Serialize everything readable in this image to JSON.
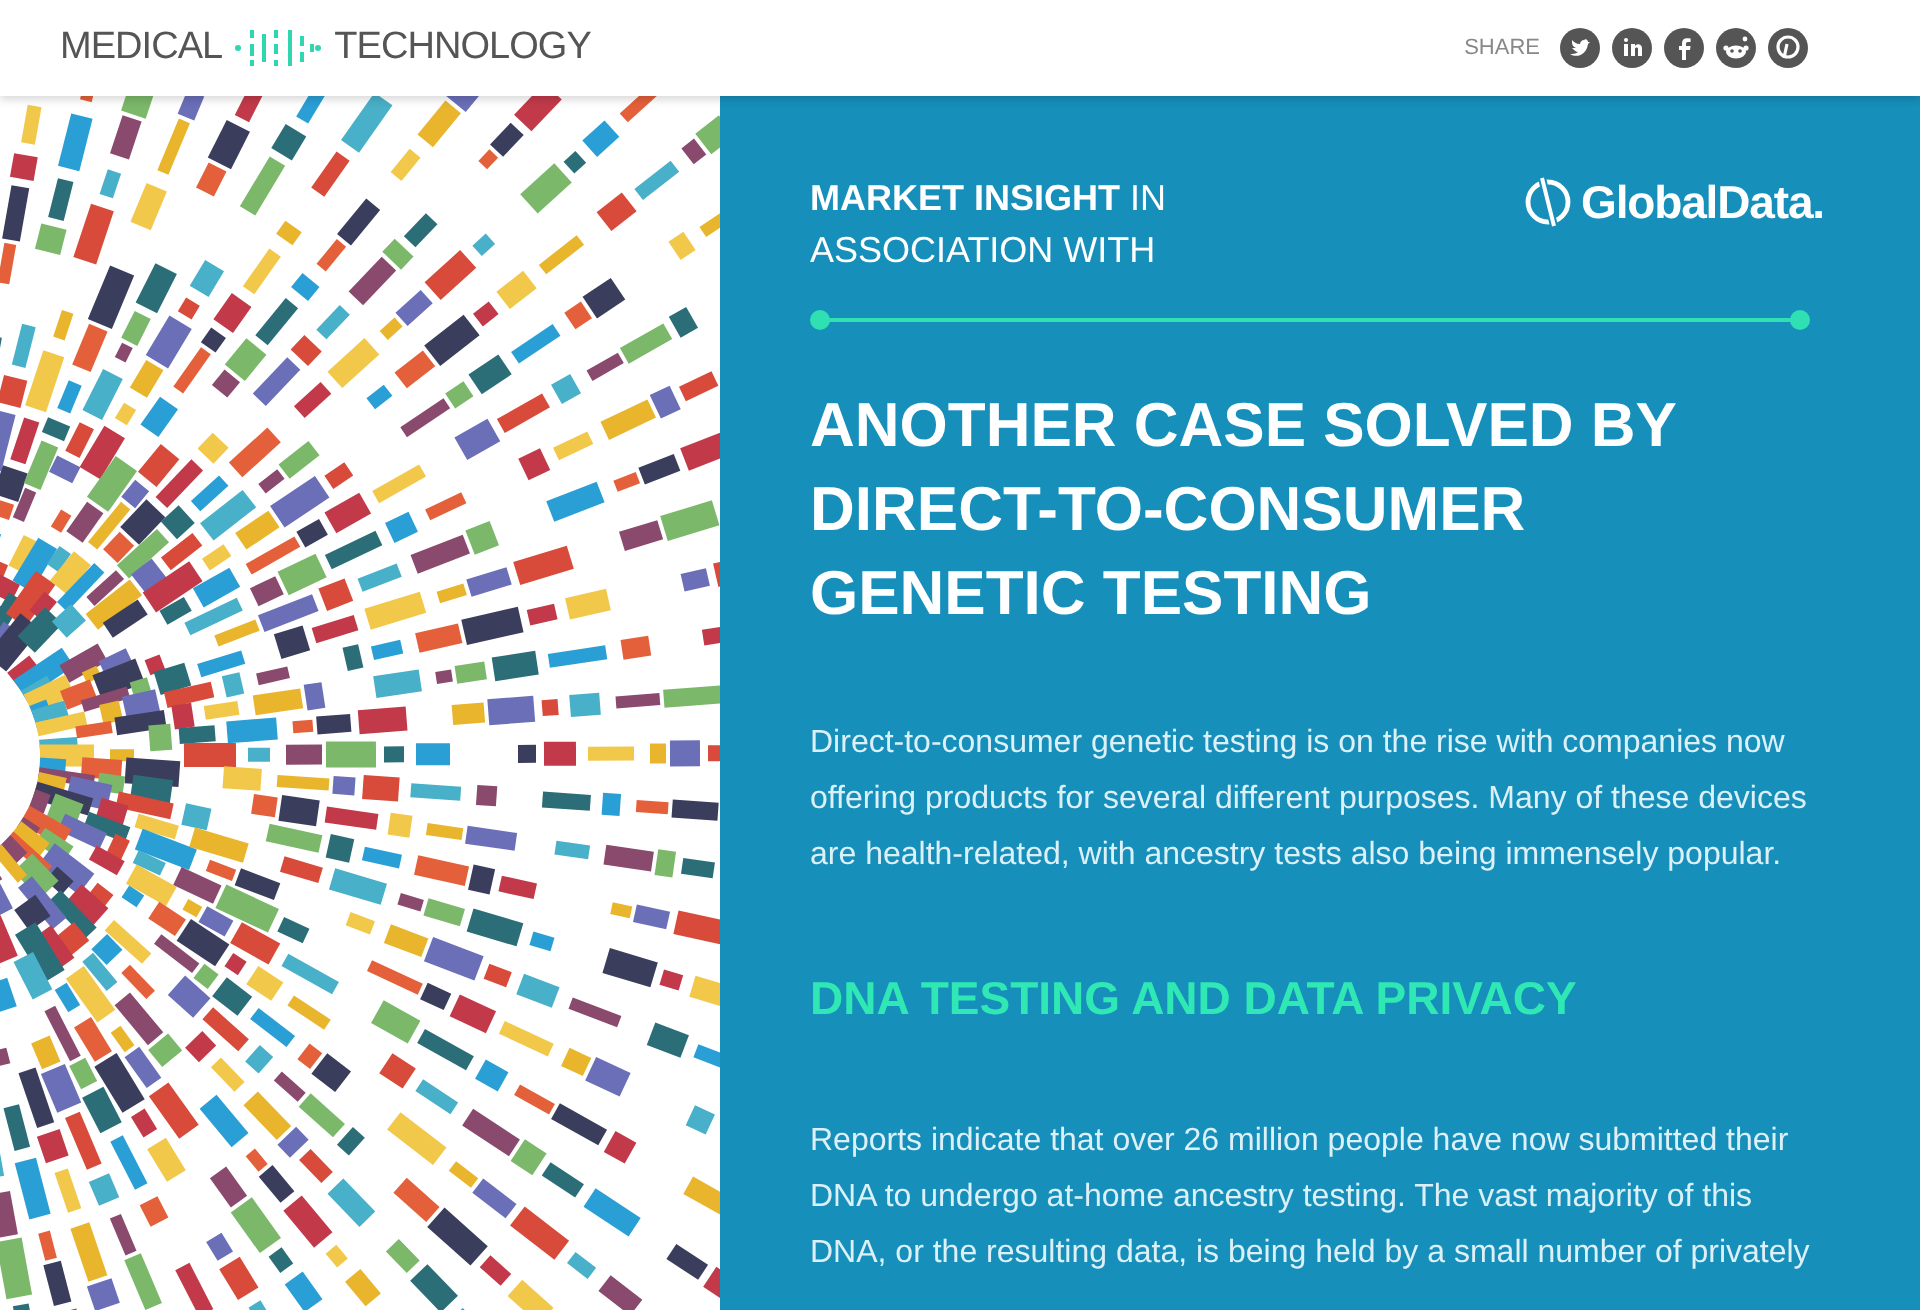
{
  "header": {
    "logo_left": "MEDICAL",
    "logo_right": "TECHNOLOGY",
    "share_label": "SHARE"
  },
  "panel": {
    "insight": "**MARKET INSIGHT** IN ASSOCIATION WITH",
    "partner": "GlobalData.",
    "title": "ANOTHER CASE SOLVED BY DIRECT-TO-CONSUMER GENETIC TESTING",
    "intro": "Direct-to-consumer genetic testing is on the rise with companies now offering products for several different purposes. Many of these devices are health-related, with ancestry tests also being immensely popular.",
    "subheading": "DNA TESTING AND DATA PRIVACY",
    "body": "Reports indicate that over 26 million people have now submitted their DNA to undergo at-home ancestry testing. The vast majority of this DNA, or the resulting data, is being held by a small number of privately"
  }
}
